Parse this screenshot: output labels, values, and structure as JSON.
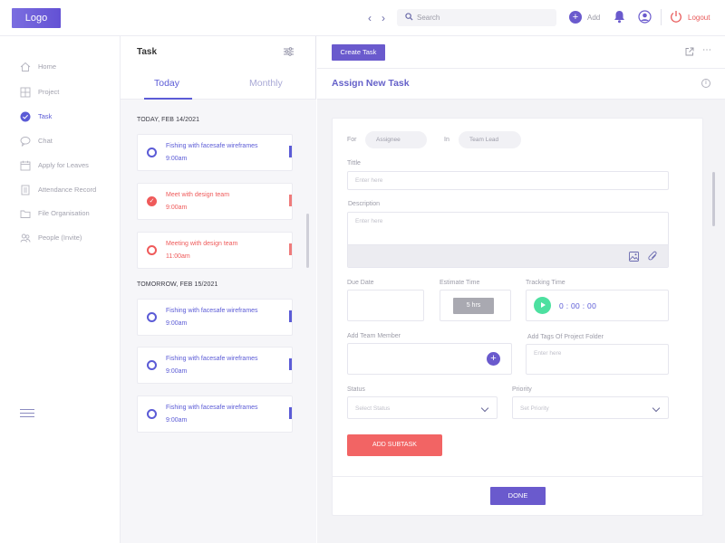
{
  "topbar": {
    "logo": "Logo",
    "search_placeholder": "Search",
    "add_label": "Add",
    "logout_label": "Logout",
    "prev_icon": "chevron-left-icon",
    "next_icon": "chevron-right-icon"
  },
  "sidebar": {
    "items": [
      {
        "label": "Home",
        "icon": "home-icon"
      },
      {
        "label": "Project",
        "icon": "grid-icon"
      },
      {
        "label": "Task",
        "icon": "check-circle-icon",
        "active": true
      },
      {
        "label": "Chat",
        "icon": "chat-icon"
      },
      {
        "label": "Apply for Leaves",
        "icon": "calendar-icon"
      },
      {
        "label": "Attendance Record",
        "icon": "document-icon"
      },
      {
        "label": "File Organisation",
        "icon": "folder-icon"
      },
      {
        "label": "People (Invite)",
        "icon": "people-icon"
      }
    ]
  },
  "tasks": {
    "title": "Task",
    "tabs": [
      "Today",
      "Monthly"
    ],
    "groups": [
      {
        "date": "TODAY, FEB 14/2021",
        "items": [
          {
            "title": "Fishing with facesafe wireframes",
            "time": "9:00am",
            "color": "#5b5bd6"
          },
          {
            "title": "Meet with design team",
            "time": "9:00am",
            "color": "#ef5a5a",
            "done": true
          },
          {
            "title": "Meeting with design team",
            "time": "11:00am",
            "color": "#ef5a5a"
          }
        ]
      },
      {
        "date": "TOMORROW, FEB 15/2021",
        "items": [
          {
            "title": "Fishing with facesafe wireframes",
            "time": "9:00am",
            "color": "#5b5bd6"
          },
          {
            "title": "Fishing with facesafe wireframes",
            "time": "9:00am",
            "color": "#5b5bd6"
          },
          {
            "title": "Fishing with facesafe wireframes",
            "time": "9:00am",
            "color": "#5b5bd6"
          }
        ]
      }
    ]
  },
  "main": {
    "create_button": "Create Task",
    "heading": "Assign New Task",
    "form": {
      "for_label": "For",
      "assignee_placeholder": "Assignee",
      "in_label": "In",
      "team_lead_placeholder": "Team Lead",
      "title_label": "Tittle",
      "title_placeholder": "Enter here",
      "description_label": "Description",
      "description_placeholder": "Enter here",
      "due_date_label": "Due Date",
      "estimate_label": "Estimate Time",
      "estimate_value": "5 hrs",
      "tracking_label": "Tracking Time",
      "tracking_value": "0 : 00 : 00",
      "team_member_label": "Add Team Member",
      "tags_label": "Add Tags Of Project Folder",
      "tags_placeholder": "Enter here",
      "status_label": "Status",
      "status_placeholder": "Select Status",
      "priority_label": "Priority",
      "priority_placeholder": "Set Priority",
      "subtask_button": "ADD SUBTASK",
      "done_button": "DONE"
    }
  },
  "colors": {
    "accent": "#6a5acd",
    "danger": "#ef5a5a",
    "success": "#4de0a0"
  }
}
